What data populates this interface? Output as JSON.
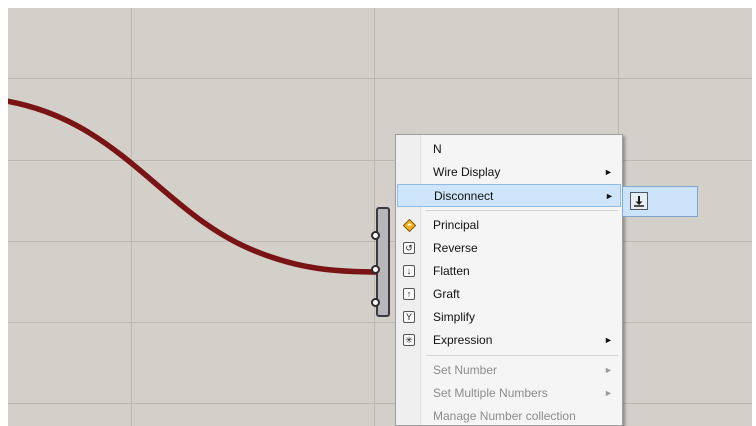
{
  "canvas": {
    "background": "#d3d0c9",
    "wire_color": "#7a1414"
  },
  "context_menu": {
    "items": [
      {
        "label": "N",
        "icon": "",
        "submenu": false,
        "enabled": true
      },
      {
        "label": "Wire Display",
        "icon": "",
        "submenu": true,
        "enabled": true
      },
      {
        "label": "Disconnect",
        "icon": "",
        "submenu": true,
        "enabled": true,
        "highlighted": true
      },
      {
        "label": "Principal",
        "icon": "principal-diamond-icon",
        "submenu": false,
        "enabled": true
      },
      {
        "label": "Reverse",
        "icon": "reverse-icon",
        "submenu": false,
        "enabled": true
      },
      {
        "label": "Flatten",
        "icon": "flatten-icon",
        "submenu": false,
        "enabled": true
      },
      {
        "label": "Graft",
        "icon": "graft-icon",
        "submenu": false,
        "enabled": true
      },
      {
        "label": "Simplify",
        "icon": "simplify-icon",
        "submenu": false,
        "enabled": true
      },
      {
        "label": "Expression",
        "icon": "expression-icon",
        "submenu": true,
        "enabled": true
      },
      {
        "label": "Set Number",
        "icon": "",
        "submenu": true,
        "enabled": false
      },
      {
        "label": "Set Multiple Numbers",
        "icon": "",
        "submenu": true,
        "enabled": false
      },
      {
        "label": "Manage Number collection",
        "icon": "",
        "submenu": false,
        "enabled": false
      }
    ],
    "submenu_arrow": "►",
    "icon_glyphs": {
      "reverse": "↺",
      "flatten": "↓",
      "graft": "↑",
      "simplify": "Y",
      "expression": "✳"
    }
  },
  "disconnect_submenu": {
    "button_icon": "disconnect-wire-icon"
  }
}
